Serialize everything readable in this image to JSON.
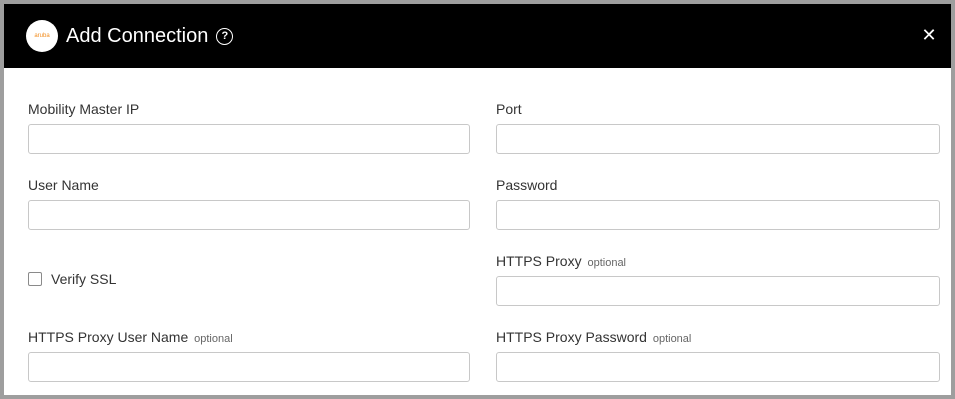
{
  "dialog": {
    "title": "Add Connection",
    "logo_text": "aruba",
    "help_glyph": "?",
    "close_glyph": "✕"
  },
  "fields": {
    "mobility_master_ip": {
      "label": "Mobility Master IP",
      "value": ""
    },
    "port": {
      "label": "Port",
      "value": ""
    },
    "user_name": {
      "label": "User Name",
      "value": ""
    },
    "password": {
      "label": "Password",
      "value": ""
    },
    "https_proxy": {
      "label": "HTTPS Proxy",
      "tag": "optional",
      "value": ""
    },
    "https_proxy_user_name": {
      "label": "HTTPS Proxy User Name",
      "tag": "optional",
      "value": ""
    },
    "https_proxy_password": {
      "label": "HTTPS Proxy Password",
      "tag": "optional",
      "value": ""
    }
  },
  "verify_ssl": {
    "label": "Verify SSL",
    "checked": false
  },
  "colors": {
    "header_bg": "#000000",
    "logo_accent": "#f28c1d"
  }
}
